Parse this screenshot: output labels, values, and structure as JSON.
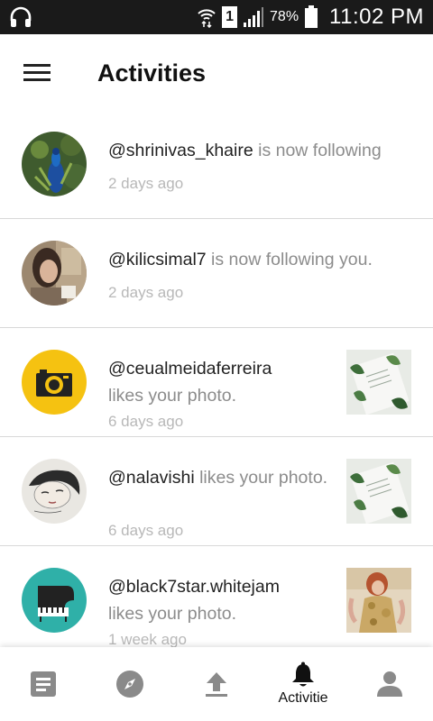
{
  "status_bar": {
    "battery_percent": "78%",
    "time": "11:02 PM",
    "sim_label": "1",
    "icons": [
      "headphones-icon",
      "wifi-data-icon",
      "sim-icon",
      "signal-icon",
      "battery-icon"
    ]
  },
  "header": {
    "title": "Activities",
    "menu_icon": "hamburger-menu-icon"
  },
  "activities": [
    {
      "username": "@shrinivas_khaire",
      "action": " is now following",
      "time": "2 days ago",
      "avatar": "peacock-photo",
      "thumbnail": null
    },
    {
      "username": "@kilicsimal7",
      "action": " is now following you.",
      "time": "2 days ago",
      "avatar": "person-photo",
      "thumbnail": null
    },
    {
      "username": "@ceualmeidaferreira",
      "action": "likes your photo.",
      "time": "6 days ago",
      "avatar": "camera-icon",
      "thumbnail": "leaf-notebook-photo"
    },
    {
      "username": "@nalavishi",
      "action": " likes your photo.",
      "time": "6 days ago",
      "avatar": "portrait-sketch",
      "thumbnail": "leaf-notebook-photo"
    },
    {
      "username": "@black7star.whitejam",
      "action": "likes your photo.",
      "time": "1 week ago",
      "avatar": "piano-icon",
      "thumbnail": "woman-gold-dress-photo"
    }
  ],
  "bottom_nav": {
    "items": [
      {
        "icon": "feed-icon",
        "label": ""
      },
      {
        "icon": "compass-icon",
        "label": ""
      },
      {
        "icon": "upload-icon",
        "label": ""
      },
      {
        "icon": "bell-icon",
        "label": "Activitie",
        "active": true
      },
      {
        "icon": "profile-icon",
        "label": ""
      }
    ]
  },
  "colors": {
    "status_bar_bg": "#1a1a1a",
    "camera_avatar_bg": "#f5c211",
    "piano_avatar_bg": "#2fb0a8",
    "nav_icon_inactive": "#8a8a8a",
    "nav_icon_active": "#111111",
    "secondary_text": "#8c8c8c",
    "timestamp_text": "#b8b8b8"
  }
}
